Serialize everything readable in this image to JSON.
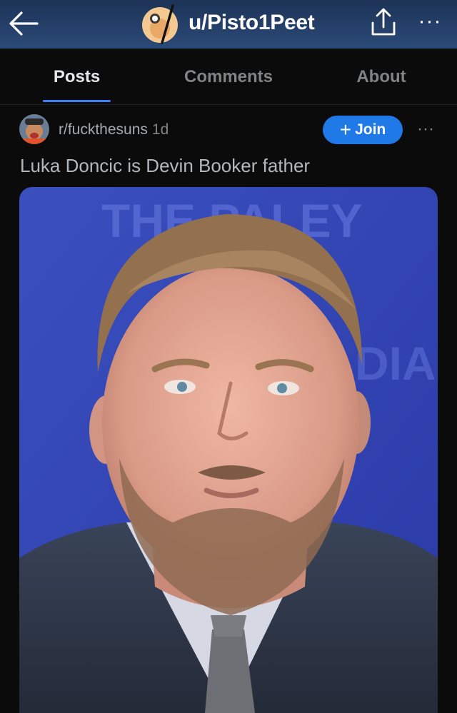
{
  "header": {
    "back_icon": "arrow-left-icon",
    "avatar_icon": "reddit-snoo-avatar",
    "username": "u/Pisto1Peet",
    "share_icon": "share-upload-icon",
    "more_icon": "ellipsis-icon",
    "more_label": "···",
    "background_color": "#1d3357"
  },
  "tabs": [
    {
      "label": "Posts",
      "active": true
    },
    {
      "label": "Comments",
      "active": false
    },
    {
      "label": "About",
      "active": false
    }
  ],
  "post": {
    "subreddit": "r/fuckthesuns",
    "age": "1d",
    "join_label": "Join",
    "join_icon": "plus-icon",
    "more_label": "···",
    "title": "Luka Doncic is Devin Booker father",
    "image_alt": "Photo of a man with short brown hair and a beard wearing a dark suit, white shirt and grey tie in front of a blue backdrop",
    "backdrop_text": "THE PALEY",
    "backdrop_text_2": "DIA"
  },
  "colors": {
    "accent": "#1f7ae8",
    "tab_underline": "#3b82f6",
    "background": "#0b0b0c"
  }
}
